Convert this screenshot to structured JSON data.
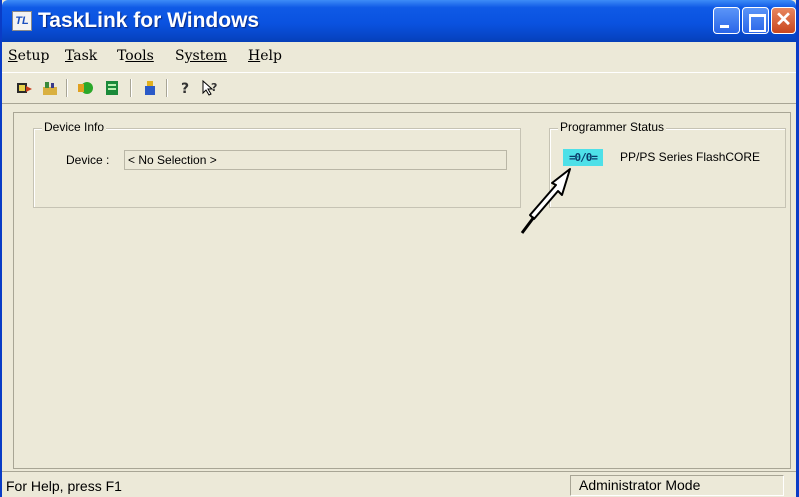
{
  "window": {
    "title": "TaskLink for Windows",
    "app_icon_text": "TL"
  },
  "menu": {
    "items": [
      {
        "label": "Setup",
        "accel": "S",
        "rest": "etup"
      },
      {
        "label": "Task",
        "accel": "T",
        "rest": "ask"
      },
      {
        "label": "Tools",
        "accel": "T",
        "rest": "ools",
        "prefix": ""
      },
      {
        "label": "System",
        "accel": "S",
        "rest": "ystem"
      },
      {
        "label": "Help",
        "accel": "H",
        "rest": "elp"
      }
    ]
  },
  "toolbar": {
    "icons": [
      "device-select-icon",
      "open-task-icon",
      "run-program-icon",
      "task-list-icon",
      "programmer-icon",
      "help-icon",
      "context-help-icon"
    ]
  },
  "device_info": {
    "group_label": "Device Info",
    "device_label": "Device :",
    "device_value": "< No Selection >"
  },
  "programmer_status": {
    "group_label": "Programmer Status",
    "badge_text": "=0/0=",
    "programmer_name": "PP/PS Series FlashCORE",
    "badge_color": "#4ee0e8"
  },
  "statusbar": {
    "help_text": "For Help, press F1",
    "mode_text": "Administrator Mode"
  },
  "colors": {
    "titlebar": "#0a52e0",
    "window_bg": "#ece9d8",
    "close_button": "#c9461e"
  }
}
